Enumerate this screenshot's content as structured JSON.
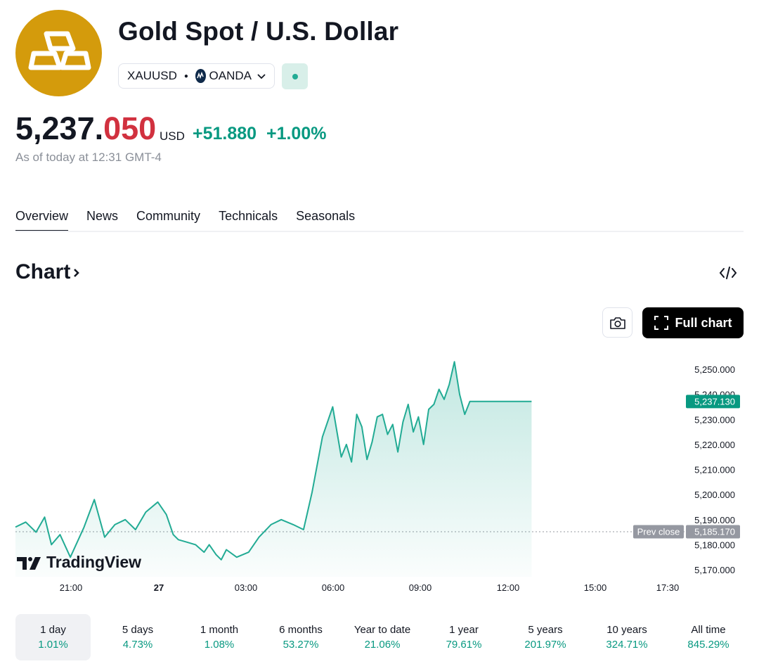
{
  "header": {
    "title": "Gold Spot / U.S. Dollar",
    "symbol": "XAUUSD",
    "exchange": "OANDA",
    "logo_icon": "gold-bars-icon",
    "exchange_icon": "oanda-icon",
    "market_status": "open"
  },
  "quote": {
    "price_int": "5,237.",
    "price_dec": "050",
    "currency": "USD",
    "change": "+51.880",
    "change_pct": "+1.00%",
    "as_of": "As of today at 12:31 GMT-4"
  },
  "tabs": [
    {
      "label": "Overview",
      "active": true
    },
    {
      "label": "News"
    },
    {
      "label": "Community"
    },
    {
      "label": "Technicals"
    },
    {
      "label": "Seasonals"
    }
  ],
  "chart_section": {
    "heading": "Chart",
    "full_chart_label": "Full chart",
    "snapshot_icon": "camera-icon",
    "embed_icon": "code-icon",
    "watermark": "TradingView"
  },
  "colors": {
    "up": "#089981",
    "line": "#22ab94",
    "down": "#d1313f",
    "gold": "#d49b0c"
  },
  "chart_data": {
    "type": "area",
    "x_ticks": [
      "21:00",
      "27",
      "03:00",
      "06:00",
      "09:00",
      "12:00",
      "15:00",
      "17:30"
    ],
    "y_ticks": [
      "5,250.000",
      "5,240.000",
      "5,230.000",
      "5,220.000",
      "5,210.000",
      "5,200.000",
      "5,190.000",
      "5,180.000",
      "5,170.000"
    ],
    "ylim": [
      5165,
      5255
    ],
    "last_value_label": "5,237.130",
    "prev_close_label": "Prev close",
    "prev_close_value": "5,185.170",
    "prev_close": 5185.17,
    "x_hours": [
      0,
      0.6,
      1.2,
      1.7,
      2.1,
      2.6,
      3.2,
      4.0,
      4.6,
      5.2,
      5.8,
      6.4,
      7.0,
      7.6,
      8.3,
      8.8,
      9.2,
      9.5,
      10.0,
      10.5,
      11.0,
      11.3,
      11.7,
      12.0,
      12.3,
      12.9,
      13.6,
      14.2,
      14.9,
      15.5,
      16.2,
      16.8,
      17.3,
      17.9,
      18.5,
      19.0,
      19.3,
      19.6,
      19.9,
      20.2,
      20.5,
      20.8,
      21.1,
      21.4,
      21.7,
      22.0,
      22.3,
      22.6,
      22.9,
      23.2,
      23.5,
      23.8,
      24.1,
      24.4,
      24.7,
      25.0,
      25.3,
      25.6,
      25.9,
      26.2,
      26.5,
      26.8,
      27.1,
      27.4,
      27.7,
      28.0,
      28.3,
      28.6,
      28.9,
      29.1,
      29.3,
      29.5,
      29.7,
      29.9,
      30.1
    ],
    "values": [
      5187,
      5189,
      5185,
      5191,
      5180,
      5184,
      5175,
      5187,
      5198,
      5183,
      5188,
      5190,
      5186,
      5193,
      5197,
      5192,
      5184,
      5182,
      5181,
      5180,
      5177,
      5180,
      5176,
      5174,
      5178,
      5175,
      5177,
      5183,
      5188,
      5190,
      5188,
      5186,
      5201,
      5223,
      5235,
      5215,
      5220,
      5213,
      5232,
      5227,
      5214,
      5221,
      5231,
      5232,
      5224,
      5228,
      5217,
      5229,
      5236,
      5225,
      5231,
      5220,
      5234,
      5236,
      5242,
      5238,
      5244,
      5253,
      5240,
      5232,
      5237.13,
      5237.13,
      5237.13,
      5237.13,
      5237.13,
      5237.13,
      5237.13,
      5237.13,
      5237.13,
      5237.13,
      5237.13,
      5237.13,
      5237.13,
      5237.13,
      5237.13
    ]
  },
  "ranges": [
    {
      "label": "1 day",
      "pct": "1.01%",
      "active": true
    },
    {
      "label": "5 days",
      "pct": "4.73%"
    },
    {
      "label": "1 month",
      "pct": "1.08%"
    },
    {
      "label": "6 months",
      "pct": "53.27%"
    },
    {
      "label": "Year to date",
      "pct": "21.06%"
    },
    {
      "label": "1 year",
      "pct": "79.61%"
    },
    {
      "label": "5 years",
      "pct": "201.97%"
    },
    {
      "label": "10 years",
      "pct": "324.71%"
    },
    {
      "label": "All time",
      "pct": "845.29%"
    }
  ]
}
